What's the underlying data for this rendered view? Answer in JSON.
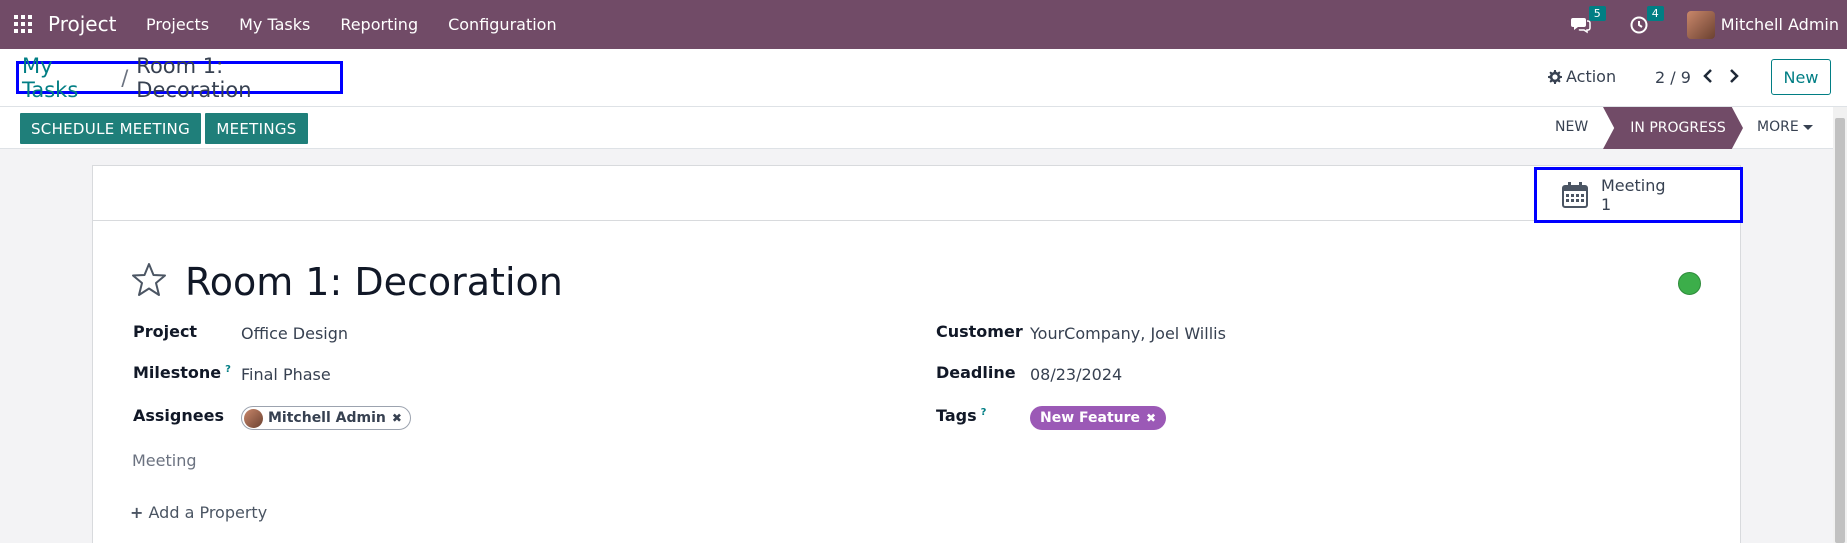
{
  "navbar": {
    "brand": "Project",
    "menu": [
      "Projects",
      "My Tasks",
      "Reporting",
      "Configuration"
    ],
    "messages_count": "5",
    "activities_count": "4",
    "user_name": "Mitchell Admin"
  },
  "control_panel": {
    "breadcrumb_parent": "My Tasks",
    "breadcrumb_separator": "/",
    "breadcrumb_current": "Room 1: Decoration",
    "action_label": "Action",
    "pager": "2 / 9",
    "new_label": "New"
  },
  "header": {
    "schedule_meeting_label": "SCHEDULE MEETING",
    "meetings_label": "MEETINGS",
    "stages": {
      "new": "NEW",
      "in_progress": "IN PROGRESS",
      "more": "MORE"
    }
  },
  "stat_button": {
    "label": "Meeting",
    "value": "1"
  },
  "form": {
    "title": "Room 1: Decoration",
    "fields": {
      "project_label": "Project",
      "project_value": "Office Design",
      "milestone_label": "Milestone",
      "milestone_value": "Final Phase",
      "assignees_label": "Assignees",
      "assignee_tag": "Mitchell Admin",
      "customer_label": "Customer",
      "customer_value": "YourCompany, Joel Willis",
      "deadline_label": "Deadline",
      "deadline_value": "08/23/2024",
      "tags_label": "Tags",
      "tag_value": "New Feature",
      "meeting_label": "Meeting",
      "help_mark": "?"
    },
    "add_property_label": "Add a Property"
  },
  "colors": {
    "navbar": "#714b67",
    "accent": "#017e84",
    "header_button": "#1f7f7a",
    "tag_feature": "#9b59b6",
    "status_green": "#3cae4a"
  }
}
